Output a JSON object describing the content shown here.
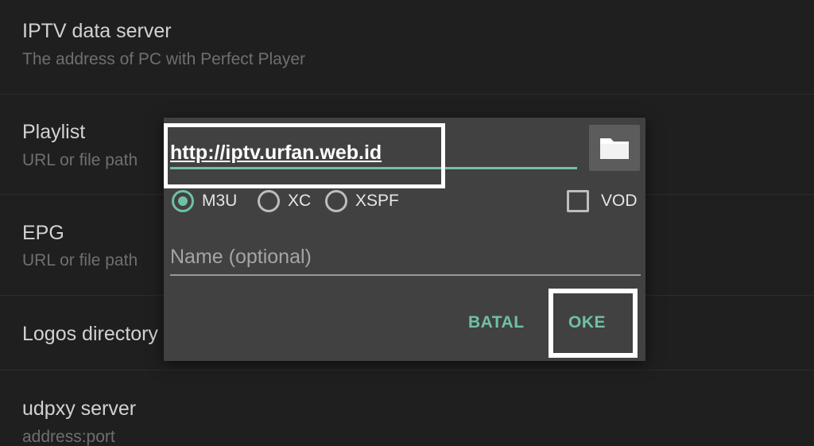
{
  "settings": {
    "items": [
      {
        "title": "IPTV data server",
        "subtitle": "The address of PC with Perfect Player"
      },
      {
        "title": "Playlist",
        "subtitle": "URL or file path"
      },
      {
        "title": "EPG",
        "subtitle": "URL or file path"
      },
      {
        "title": "Logos directory",
        "subtitle": ""
      },
      {
        "title": "udpxy server",
        "subtitle": "address:port"
      }
    ]
  },
  "dialog": {
    "url_value": "http://iptv.urfan.web.id",
    "folder_icon": "folder-icon",
    "formats": [
      {
        "label": "M3U",
        "checked": true
      },
      {
        "label": "XC",
        "checked": false
      },
      {
        "label": "XSPF",
        "checked": false
      }
    ],
    "vod_label": "VOD",
    "vod_checked": false,
    "name_placeholder": "Name (optional)",
    "cancel_label": "BATAL",
    "ok_label": "OKE"
  },
  "colors": {
    "accent": "#6fc0a6",
    "background": "#1f1f1f",
    "dialog": "#414141",
    "highlight": "#ffffff"
  }
}
